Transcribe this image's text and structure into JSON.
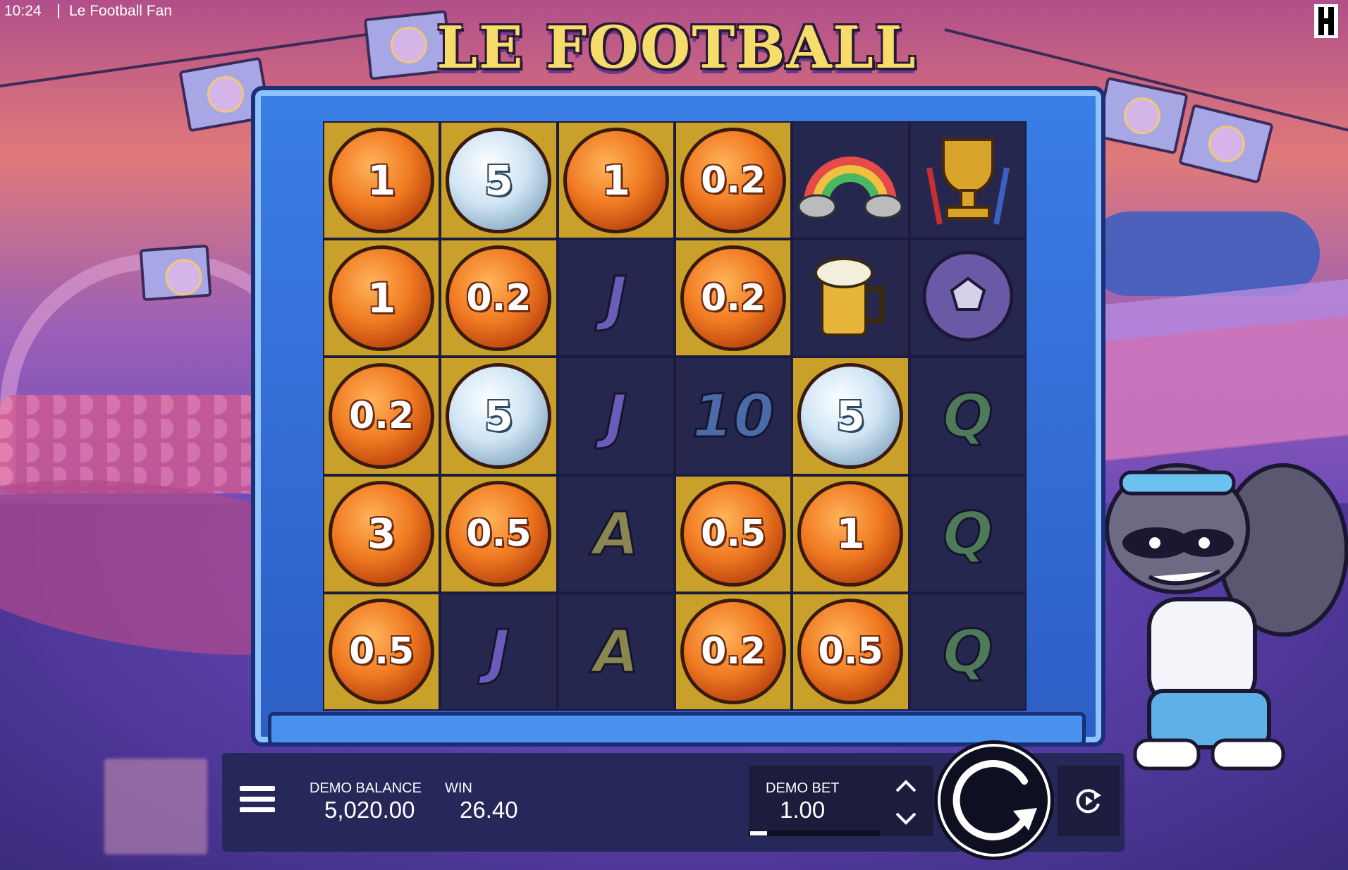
{
  "status_bar": {
    "time": "10:24",
    "app_title": "Le Football Fan"
  },
  "game": {
    "title": "LE FOOTBALL FAN"
  },
  "reels": [
    [
      {
        "type": "coin",
        "tier": "bronze",
        "value": "1",
        "hl": true
      },
      {
        "type": "coin",
        "tier": "silver",
        "value": "5",
        "hl": true
      },
      {
        "type": "coin",
        "tier": "bronze",
        "value": "1",
        "hl": true
      },
      {
        "type": "coin",
        "tier": "bronze",
        "value": "0.2",
        "hl": true
      },
      {
        "type": "symbol",
        "name": "rainbow",
        "hl": false
      },
      {
        "type": "symbol",
        "name": "trophy",
        "hl": false
      }
    ],
    [
      {
        "type": "coin",
        "tier": "bronze",
        "value": "1",
        "hl": true
      },
      {
        "type": "coin",
        "tier": "bronze",
        "value": "0.2",
        "hl": true
      },
      {
        "type": "card",
        "value": "J",
        "hl": false
      },
      {
        "type": "coin",
        "tier": "bronze",
        "value": "0.2",
        "hl": true
      },
      {
        "type": "symbol",
        "name": "beer",
        "hl": false
      },
      {
        "type": "symbol",
        "name": "football",
        "hl": false
      }
    ],
    [
      {
        "type": "coin",
        "tier": "bronze",
        "value": "0.2",
        "hl": true
      },
      {
        "type": "coin",
        "tier": "silver",
        "value": "5",
        "hl": true
      },
      {
        "type": "card",
        "value": "J",
        "hl": false
      },
      {
        "type": "card",
        "value": "10",
        "hl": false
      },
      {
        "type": "coin",
        "tier": "silver",
        "value": "5",
        "hl": true
      },
      {
        "type": "card",
        "value": "Q",
        "hl": false
      }
    ],
    [
      {
        "type": "coin",
        "tier": "bronze",
        "value": "3",
        "hl": true
      },
      {
        "type": "coin",
        "tier": "bronze",
        "value": "0.5",
        "hl": true
      },
      {
        "type": "card",
        "value": "A",
        "hl": false
      },
      {
        "type": "coin",
        "tier": "bronze",
        "value": "0.5",
        "hl": true
      },
      {
        "type": "coin",
        "tier": "bronze",
        "value": "1",
        "hl": true
      },
      {
        "type": "card",
        "value": "Q",
        "hl": false
      }
    ],
    [
      {
        "type": "coin",
        "tier": "bronze",
        "value": "0.5",
        "hl": true
      },
      {
        "type": "card",
        "value": "J",
        "hl": false
      },
      {
        "type": "card",
        "value": "A",
        "hl": false
      },
      {
        "type": "coin",
        "tier": "bronze",
        "value": "0.2",
        "hl": true
      },
      {
        "type": "coin",
        "tier": "bronze",
        "value": "0.5",
        "hl": true
      },
      {
        "type": "card",
        "value": "Q",
        "hl": false
      }
    ]
  ],
  "hud": {
    "balance_label": "DEMO BALANCE",
    "balance_value": "5,020.00",
    "win_label": "WIN",
    "win_value": "26.40",
    "bet_label": "DEMO BET",
    "bet_value": "1.00"
  },
  "colors": {
    "accent": "#c9a12a",
    "panel": "#26285a",
    "frame": "#3a7ee6"
  },
  "icons": {
    "menu": "hamburger-icon",
    "up": "chevron-up-icon",
    "down": "chevron-down-icon",
    "spin": "spin-arrow-icon",
    "autoplay": "autoplay-icon",
    "brand": "provider-logo-icon"
  }
}
